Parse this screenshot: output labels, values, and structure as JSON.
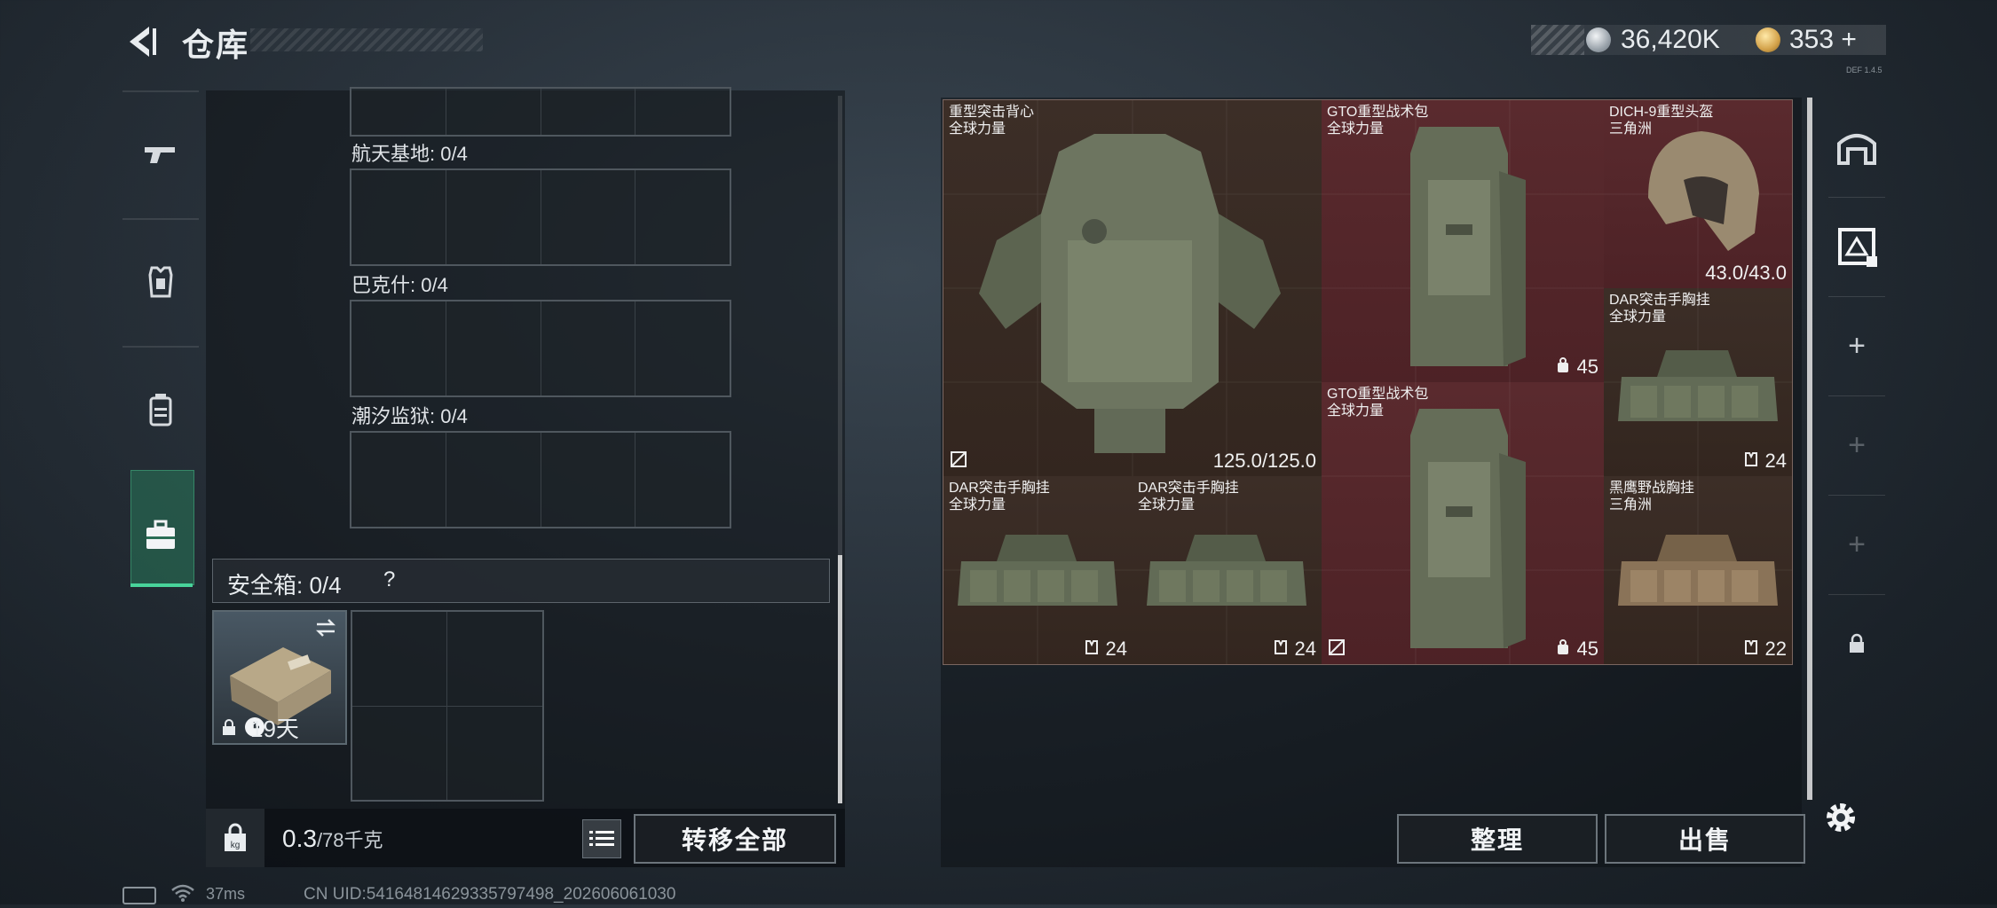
{
  "header": {
    "title": "仓库",
    "currency_silver": "36,420K",
    "currency_gold": "353",
    "currency_gold_add": "+",
    "version": "DEF 1.4.5"
  },
  "left_tabs": [
    {
      "icon": "pistol-icon"
    },
    {
      "icon": "armor-icon"
    },
    {
      "icon": "backpack-icon"
    },
    {
      "icon": "briefcase-icon",
      "active": true
    }
  ],
  "storage": {
    "sections": [
      {
        "label": "航天基地: 0/4"
      },
      {
        "label": "巴克什: 0/4"
      },
      {
        "label": "潮汐监狱: 0/4"
      }
    ],
    "safe_box_label": "安全箱: 0/4",
    "safe_box_help": "?",
    "safe_item_days": "19天",
    "weight_value": "0.3",
    "weight_total": "/78千克",
    "transfer_all": "转移全部"
  },
  "items": [
    {
      "name": "重型突击背心",
      "origin": "全球力量",
      "value": "125.0/125.0",
      "kind": "vest"
    },
    {
      "name": "GTO重型战术包",
      "origin": "全球力量",
      "value": "45",
      "kind": "backpack"
    },
    {
      "name": "DICH-9重型头盔",
      "origin": "三角洲",
      "value": "43.0/43.0",
      "kind": "helmet"
    },
    {
      "name": "DAR突击手胸挂",
      "origin": "全球力量",
      "value": "24",
      "kind": "rig"
    },
    {
      "name": "GTO重型战术包",
      "origin": "全球力量",
      "value": "45",
      "kind": "backpack"
    },
    {
      "name": "DAR突击手胸挂",
      "origin": "全球力量",
      "value": "24",
      "kind": "rig"
    },
    {
      "name": "DAR突击手胸挂",
      "origin": "全球力量",
      "value": "24",
      "kind": "rig"
    },
    {
      "name": "黑鹰野战胸挂",
      "origin": "三角洲",
      "value": "22",
      "kind": "rig-tan"
    }
  ],
  "right_side": {
    "add_symbol": "+"
  },
  "actions": {
    "sort": "整理",
    "sell": "出售"
  },
  "status_bar": {
    "ping": "37ms",
    "uid": "CN UID:5416481462933579749​8_202606061030"
  },
  "colors": {
    "accent_green": "#48d39a",
    "cell_brown": "#3c2e27",
    "cell_red": "#5a2a2e"
  }
}
